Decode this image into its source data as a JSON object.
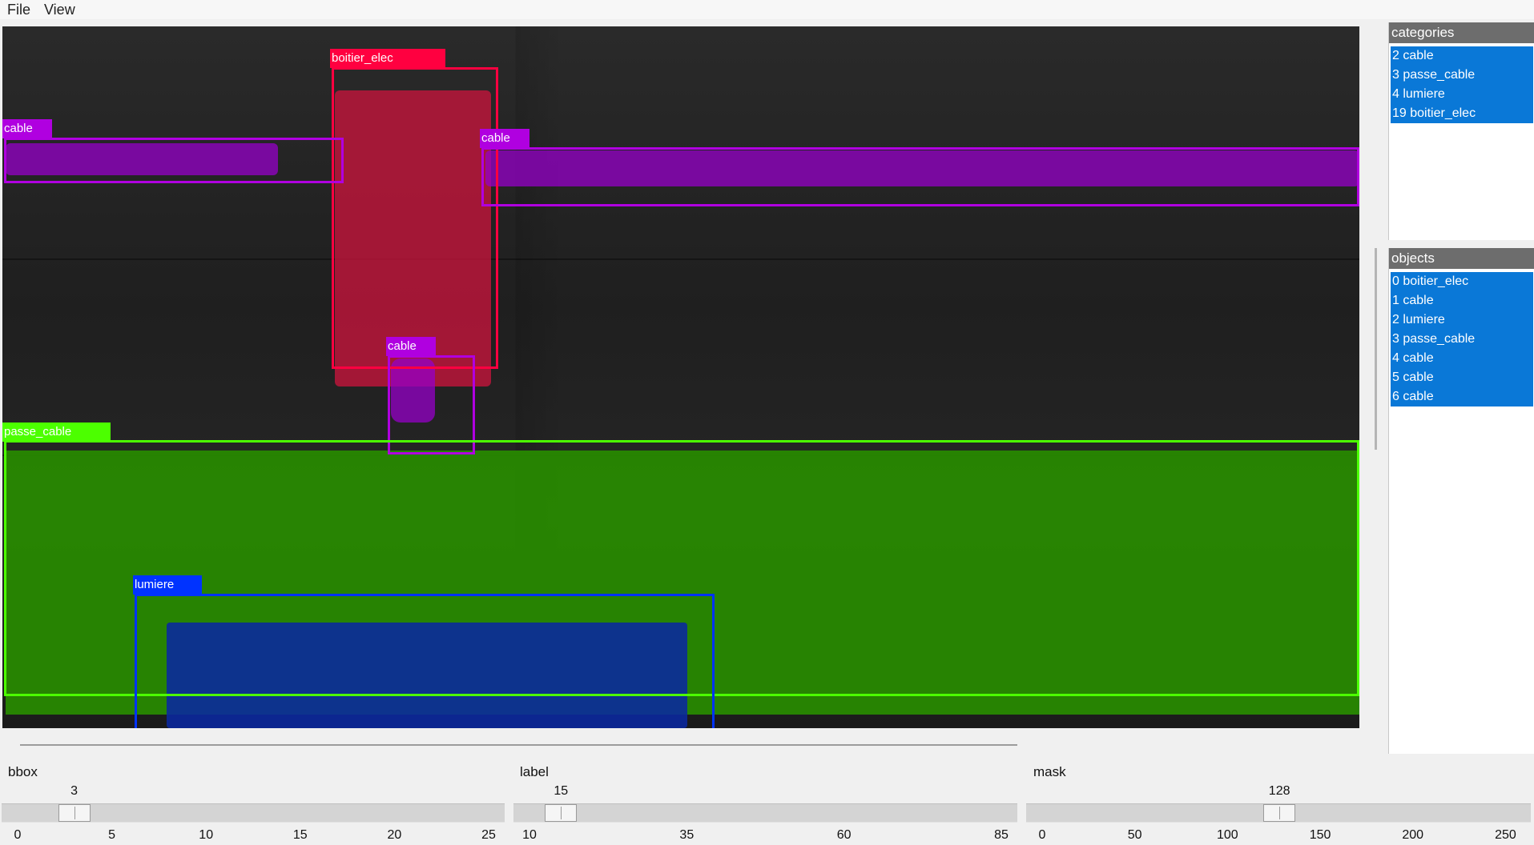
{
  "menu": {
    "file": "File",
    "view": "View"
  },
  "annotations": {
    "boitier_elec": {
      "label": "boitier_elec",
      "color": "#ff0040"
    },
    "cable_left": {
      "label": "cable",
      "color": "#b000e0"
    },
    "cable_right": {
      "label": "cable",
      "color": "#b000e0"
    },
    "cable_mid": {
      "label": "cable",
      "color": "#b000e0"
    },
    "passe_cable": {
      "label": "passe_cable",
      "color": "#4cff00"
    },
    "lumiere": {
      "label": "lumiere",
      "color": "#0033ff"
    }
  },
  "categories_panel": {
    "title": "categories",
    "items": [
      "2 cable",
      "3 passe_cable",
      "4 lumiere",
      "19 boitier_elec"
    ]
  },
  "objects_panel": {
    "title": "objects",
    "items": [
      "0 boitier_elec",
      "1 cable",
      "2 lumiere",
      "3 passe_cable",
      "4 cable",
      "5 cable",
      "6 cable"
    ]
  },
  "sliders": {
    "bbox": {
      "label": "bbox",
      "value": "3",
      "min": 0,
      "max": 25,
      "ticks": [
        "0",
        "5",
        "10",
        "15",
        "20",
        "25"
      ]
    },
    "label": {
      "label": "label",
      "value": "15",
      "min": 10,
      "max": 85,
      "ticks": [
        "10",
        "35",
        "60",
        "85"
      ]
    },
    "mask": {
      "label": "mask",
      "value": "128",
      "min": 0,
      "max": 255,
      "ticks": [
        "0",
        "50",
        "100",
        "150",
        "200",
        "250"
      ]
    }
  },
  "accent_color": "#0a78d7"
}
